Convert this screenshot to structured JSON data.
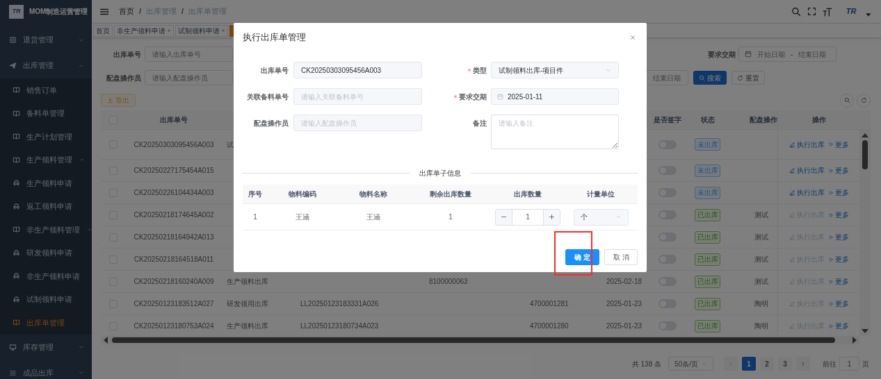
{
  "sidebar": {
    "logo": "TR",
    "title": "MOM制造运营管理",
    "items": [
      {
        "label": "退货管理",
        "expanded": false,
        "selected": false
      },
      {
        "label": "出库管理",
        "expanded": true,
        "selected": false,
        "children": [
          {
            "label": "销售订单",
            "selected": false
          },
          {
            "label": "备料单管理",
            "selected": false
          },
          {
            "label": "生产计划管理",
            "selected": false
          },
          {
            "label": "生产领料管理",
            "expanded": true,
            "selected": false,
            "children": [
              {
                "label": "生产领料申请",
                "selected": false
              },
              {
                "label": "返工领料申请",
                "selected": false
              }
            ]
          },
          {
            "label": "非生产领料管理",
            "expanded": true,
            "selected": false,
            "children": [
              {
                "label": "研发领料申请",
                "selected": false
              },
              {
                "label": "非生产领料申请",
                "selected": false
              },
              {
                "label": "试制领料申请",
                "selected": false
              }
            ]
          },
          {
            "label": "出库单管理",
            "selected": true
          }
        ]
      },
      {
        "label": "库存管理",
        "expanded": false,
        "selected": false
      },
      {
        "label": "成品出库",
        "expanded": false,
        "selected": false
      }
    ]
  },
  "header": {
    "breadcrumb": [
      "首页",
      "出库管理",
      "出库单管理"
    ],
    "breadcrumb_separator": "/",
    "avatar_logo": "TR"
  },
  "tags": [
    {
      "label": "首页",
      "closable": false,
      "selected": false
    },
    {
      "label": "非生产领料申请",
      "closable": true,
      "selected": false
    },
    {
      "label": "试制领料申请",
      "closable": true,
      "selected": false
    },
    {
      "selected": true
    }
  ],
  "filters": {
    "order_no": {
      "label": "出库单号",
      "placeholder": "请输入出库单号"
    },
    "operator": {
      "label": "配盘操作员",
      "placeholder": "请输入配盘操作员"
    },
    "due_date": {
      "label": "要求交期",
      "start_placeholder": "开始日期",
      "separator": "-",
      "end_placeholder": "结束日期"
    },
    "second_date_end_placeholder": "结束日期",
    "search_button": "搜索",
    "reset_button": "重置"
  },
  "toolbar": {
    "export_button": "导出"
  },
  "table": {
    "all_checked": false,
    "columns": {
      "order_no": "出库单号",
      "signed": "是否签字",
      "status": "状态",
      "operator": "配盘操作",
      "actions": "操作"
    },
    "rows": [
      {
        "checked": false,
        "order_no": "CK20250303095456A003",
        "column_3": "试",
        "signed": false,
        "status": {
          "label": "未出库",
          "kind": "pending"
        },
        "actions": {
          "execute": "执行出库",
          "execute_disabled": false,
          "more": "更多"
        }
      },
      {
        "checked": false,
        "order_no": "CK20250227175454A015",
        "signed": false,
        "status": {
          "label": "未出库",
          "kind": "pending"
        },
        "actions": {
          "execute": "执行出库",
          "execute_disabled": false,
          "more": "更多"
        }
      },
      {
        "checked": false,
        "order_no": "CK20250226104434A003",
        "signed": false,
        "status": {
          "label": "未出库",
          "kind": "pending"
        },
        "actions": {
          "execute": "执行出库",
          "execute_disabled": false,
          "more": "更多"
        }
      },
      {
        "checked": false,
        "order_no": "CK20250218174645A002",
        "signed": false,
        "status": {
          "label": "已出库",
          "kind": "done"
        },
        "operator": "测试",
        "actions": {
          "execute": "执行出库",
          "execute_disabled": true,
          "more": "更多"
        }
      },
      {
        "checked": false,
        "order_no": "CK20250218164942A013",
        "signed": false,
        "status": {
          "label": "已出库",
          "kind": "done"
        },
        "operator": "测试",
        "actions": {
          "execute": "执行出库",
          "execute_disabled": true,
          "more": "更多"
        }
      },
      {
        "checked": false,
        "order_no": "CK20250218164518A011",
        "signed": false,
        "status": {
          "label": "已出库",
          "kind": "done"
        },
        "operator": "测试",
        "actions": {
          "execute": "执行出库",
          "execute_disabled": true,
          "more": "更多"
        }
      },
      {
        "checked": false,
        "order_no": "CK20250218160240A009",
        "column_3": "生产领料出库",
        "column_5": "8100000063",
        "column_7": "2025-02-18",
        "signed": false,
        "status": {
          "label": "已出库",
          "kind": "done"
        },
        "operator": "测试",
        "actions": {
          "execute": "执行出库",
          "execute_disabled": true,
          "more": "更多"
        }
      },
      {
        "checked": false,
        "order_no": "CK20250123183512A027",
        "column_3": "研发领用出库",
        "column_4": "LL20250123183331A026",
        "column_6": "4700001281",
        "column_7": "2025-01-23",
        "signed": false,
        "status": {
          "label": "已出库",
          "kind": "done"
        },
        "operator": "陶明",
        "actions": {
          "execute": "执行出库",
          "execute_disabled": true,
          "more": "更多"
        }
      },
      {
        "checked": false,
        "order_no": "CK20250123180753A024",
        "column_3": "生产领料出库",
        "column_4": "LL20250123180734A023",
        "column_6": "4700001280",
        "column_7": "2025-01-23",
        "signed": false,
        "status": {
          "label": "已出库",
          "kind": "done"
        },
        "operator": "陶明",
        "actions": {
          "execute": "执行出库",
          "execute_disabled": true,
          "more": "更多"
        }
      }
    ]
  },
  "pagination": {
    "total": "共 138 条",
    "page_size": "50条/页",
    "pages": [
      {
        "label": "1",
        "selected": true
      },
      {
        "label": "2",
        "selected": false
      },
      {
        "label": "3",
        "selected": false
      }
    ],
    "goto_label": "前往",
    "goto_value": "1",
    "goto_suffix": "页"
  },
  "modal": {
    "title": "执行出库单管理",
    "fields": [
      {
        "label": "出库单号",
        "kind": "input",
        "required": false,
        "value": "CK20250303095456A003"
      },
      {
        "label": "类型",
        "kind": "select",
        "required": true,
        "value": "试制领料出库-项目件"
      },
      {
        "label": "关联备料单号",
        "kind": "input",
        "required": false,
        "placeholder": "请输入关联备料单号"
      },
      {
        "label": "要求交期",
        "kind": "date",
        "required": true,
        "value": "2025-01-11"
      },
      {
        "label": "配盘操作员",
        "kind": "input",
        "required": false,
        "placeholder": "请输入配盘操作员"
      },
      {
        "label": "备注",
        "kind": "textarea",
        "required": false,
        "placeholder": "请输入备注"
      }
    ],
    "section_title": "出库单子信息",
    "items_table": {
      "columns": [
        "序号",
        "物料编码",
        "物料名称",
        "剩余出库数量",
        "出库数量",
        "计量单位"
      ],
      "rows": [
        {
          "index": "1",
          "material_code": "王涵",
          "material_name": "王涵",
          "remaining": "1",
          "quantity": "1",
          "unit": "个"
        }
      ]
    },
    "confirm_button": "确定",
    "cancel_button": "取消",
    "confirm_highlighted": true
  }
}
